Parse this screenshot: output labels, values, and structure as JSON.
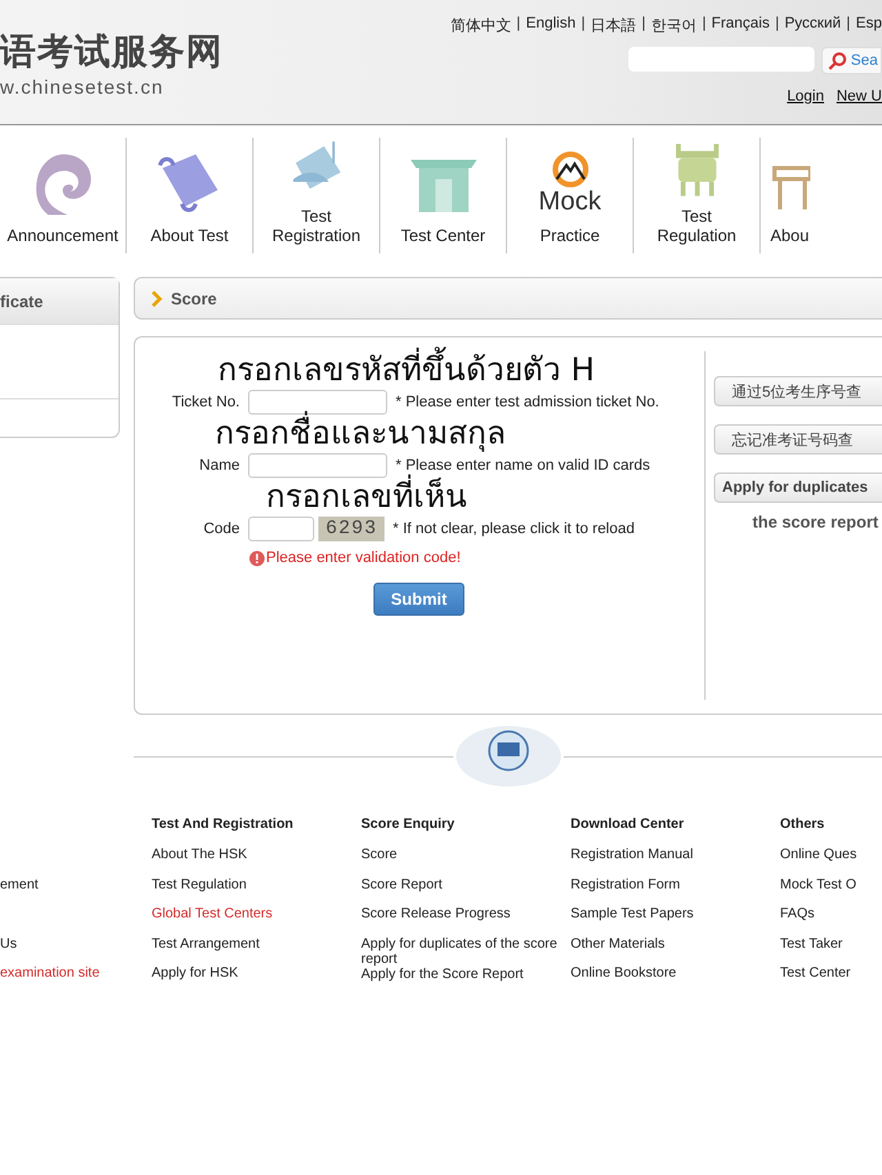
{
  "header": {
    "logo_title": "语考试服务网",
    "logo_url": "w.chinesetest.cn",
    "languages": [
      "简体中文",
      "English",
      "日本語",
      "한국어",
      "Français",
      "Русский",
      "Esp"
    ],
    "language_separator": "|",
    "search": {
      "button": "Sea"
    },
    "account_links": [
      "Login",
      "New U"
    ]
  },
  "nav": [
    {
      "label": "Announcement",
      "kind": "swirl"
    },
    {
      "label": "About Test",
      "kind": "scroll"
    },
    {
      "label": "Test Registration",
      "kind": "scroll2"
    },
    {
      "label": "Test Center",
      "kind": "gate"
    },
    {
      "label": "Practice",
      "kind": "mock",
      "icon_text": "Mock"
    },
    {
      "label": "Test Regulation",
      "kind": "vessel"
    },
    {
      "label": "Abou",
      "kind": "desk"
    }
  ],
  "sidebar": {
    "title": "ficate"
  },
  "breadcrumb": "Score",
  "form": {
    "annotations": [
      "กรอกเลขรหัสที่ขึ้นด้วยตัว H",
      "กรอกชื่อและนามสกุล",
      "กรอกเลขที่เห็น"
    ],
    "fields": [
      {
        "label": "Ticket No.",
        "hint": "* Please enter test admission ticket No.",
        "kind": "text"
      },
      {
        "label": "Name",
        "hint": "*  Please enter name on valid ID cards",
        "kind": "text"
      },
      {
        "label": "Code",
        "hint": "*  If not clear, please click it to reload",
        "kind": "captcha",
        "captcha": "6293"
      }
    ],
    "error": "Please enter validation code!",
    "submit": "Submit"
  },
  "side_buttons": [
    "通过5位考生序号查",
    "忘记准考证号码查",
    "Apply for duplicates"
  ],
  "side_note": "the score report",
  "footer": [
    {
      "links": [
        {
          "text": "ement",
          "highlighted": false
        },
        {
          "text": "Us",
          "highlighted": false
        },
        {
          "text": "examination site",
          "highlighted": true
        }
      ]
    },
    {
      "title": "Test And Registration",
      "links": [
        {
          "text": "About The HSK",
          "highlighted": false
        },
        {
          "text": "Test Regulation",
          "highlighted": false
        },
        {
          "text": "Global Test Centers",
          "highlighted": true
        },
        {
          "text": "Test Arrangement",
          "highlighted": false
        },
        {
          "text": "Apply for HSK",
          "highlighted": false
        }
      ]
    },
    {
      "title": "Score Enquiry",
      "links": [
        {
          "text": "Score",
          "highlighted": false
        },
        {
          "text": "Score Report",
          "highlighted": false
        },
        {
          "text": "Score Release Progress",
          "highlighted": false
        },
        {
          "text": "Apply for duplicates of the score report",
          "highlighted": false
        },
        {
          "text": "Apply for the Score Report",
          "highlighted": false
        }
      ]
    },
    {
      "title": "Download Center",
      "links": [
        {
          "text": "Registration Manual",
          "highlighted": false
        },
        {
          "text": "Registration Form",
          "highlighted": false
        },
        {
          "text": "Sample Test Papers",
          "highlighted": false
        },
        {
          "text": "Other Materials",
          "highlighted": false
        },
        {
          "text": "Online Bookstore",
          "highlighted": false
        }
      ]
    },
    {
      "title": "Others",
      "links": [
        {
          "text": "Online Ques",
          "highlighted": false
        },
        {
          "text": "Mock Test O",
          "highlighted": false
        },
        {
          "text": "FAQs",
          "highlighted": false
        },
        {
          "text": "Test Taker",
          "highlighted": false
        },
        {
          "text": "Test Center",
          "highlighted": false
        }
      ]
    }
  ]
}
